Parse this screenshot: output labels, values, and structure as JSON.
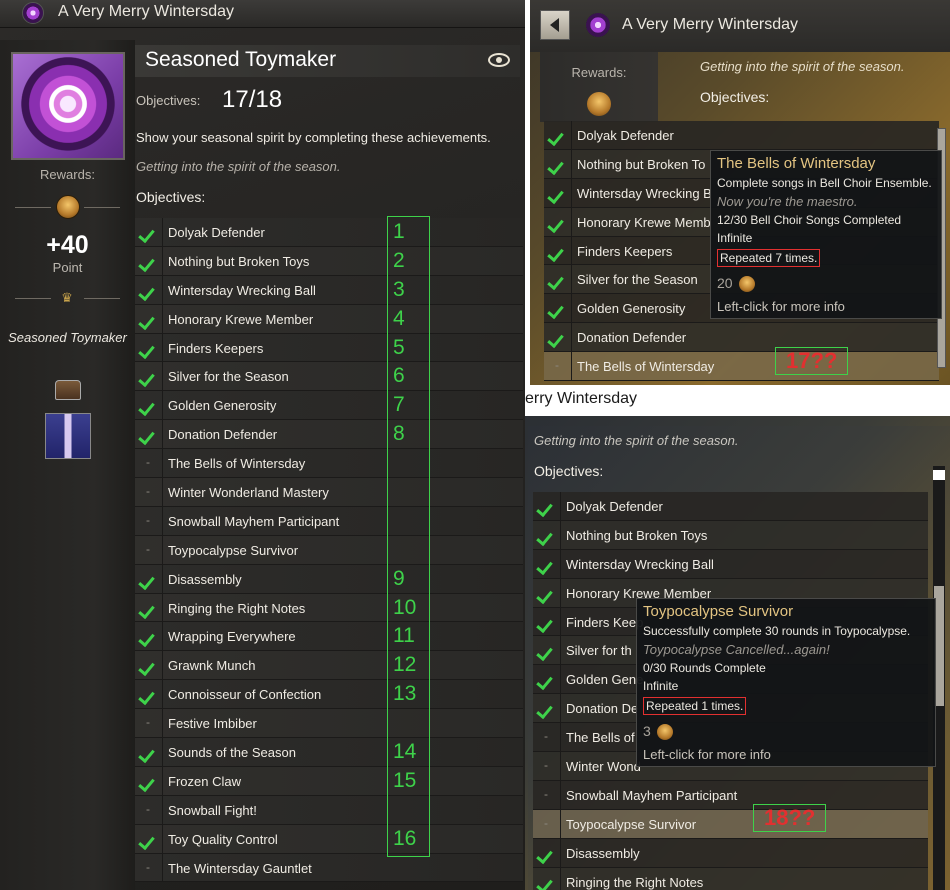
{
  "left": {
    "window_title": "A Very Merry Wintersday",
    "header_title": "Seasoned Toymaker",
    "rewards_label": "Rewards:",
    "points": "+40",
    "points_label": "Point",
    "title_reward": "Seasoned Toymaker",
    "objectives_label": "Objectives:",
    "objectives_value": "17/18",
    "description": "Show your seasonal spirit by completing these achievements.",
    "flavor": "Getting into the spirit of the season.",
    "objectives_heading": "Objectives:",
    "items": [
      {
        "label": "Dolyak Defender",
        "done": true,
        "num": "1"
      },
      {
        "label": "Nothing but Broken Toys",
        "done": true,
        "num": "2"
      },
      {
        "label": "Wintersday Wrecking Ball",
        "done": true,
        "num": "3"
      },
      {
        "label": "Honorary Krewe Member",
        "done": true,
        "num": "4"
      },
      {
        "label": "Finders Keepers",
        "done": true,
        "num": "5"
      },
      {
        "label": "Silver for the Season",
        "done": true,
        "num": "6"
      },
      {
        "label": "Golden Generosity",
        "done": true,
        "num": "7"
      },
      {
        "label": "Donation Defender",
        "done": true,
        "num": "8"
      },
      {
        "label": "The Bells of Wintersday",
        "done": false,
        "num": ""
      },
      {
        "label": "Winter Wonderland Mastery",
        "done": false,
        "num": ""
      },
      {
        "label": "Snowball Mayhem Participant",
        "done": false,
        "num": ""
      },
      {
        "label": "Toypocalypse Survivor",
        "done": false,
        "num": ""
      },
      {
        "label": "Disassembly",
        "done": true,
        "num": "9"
      },
      {
        "label": "Ringing the Right Notes",
        "done": true,
        "num": "10"
      },
      {
        "label": "Wrapping Everywhere",
        "done": true,
        "num": "11"
      },
      {
        "label": "Grawnk Munch",
        "done": true,
        "num": "12"
      },
      {
        "label": "Connoisseur of Confection",
        "done": true,
        "num": "13"
      },
      {
        "label": "Festive Imbiber",
        "done": false,
        "num": ""
      },
      {
        "label": "Sounds of the Season",
        "done": true,
        "num": "14"
      },
      {
        "label": "Frozen Claw",
        "done": true,
        "num": "15"
      },
      {
        "label": "Snowball Fight!",
        "done": false,
        "num": ""
      },
      {
        "label": "Toy Quality Control",
        "done": true,
        "num": "16"
      },
      {
        "label": "The Wintersday Gauntlet",
        "done": false,
        "num": ""
      }
    ]
  },
  "right_top": {
    "window_title": "A Very Merry Wintersday",
    "rewards_label": "Rewards:",
    "flavor": "Getting into the spirit of the season.",
    "objectives_heading": "Objectives:",
    "items": [
      {
        "label": "Dolyak Defender",
        "done": true
      },
      {
        "label": "Nothing but Broken To",
        "done": true
      },
      {
        "label": "Wintersday Wrecking B",
        "done": true
      },
      {
        "label": "Honorary Krewe Memb",
        "done": true
      },
      {
        "label": "Finders Keepers",
        "done": true
      },
      {
        "label": "Silver for the Season",
        "done": true
      },
      {
        "label": "Golden Generosity",
        "done": true
      },
      {
        "label": "Donation Defender",
        "done": true
      },
      {
        "label": "The Bells of Wintersday",
        "done": false
      }
    ],
    "tooltip": {
      "title": "The Bells of Wintersday",
      "desc": "Complete songs in Bell Choir Ensemble.",
      "flavor": "Now you're the maestro.",
      "progress": "12/30 Bell Choir Songs Completed",
      "repeat": "Infinite",
      "repeated": "Repeated 7 times.",
      "reward": "20",
      "footer": "Left-click for more info"
    },
    "annotation": "17??"
  },
  "right_bottom": {
    "window_title_partial": "erry Wintersday",
    "flavor": "Getting into the spirit of the season.",
    "objectives_heading": "Objectives:",
    "items": [
      {
        "label": "Dolyak Defender",
        "done": true
      },
      {
        "label": "Nothing but Broken Toys",
        "done": true
      },
      {
        "label": "Wintersday Wrecking Ball",
        "done": true
      },
      {
        "label": "Honorary Krewe Member",
        "done": true
      },
      {
        "label": "Finders Keep",
        "done": true
      },
      {
        "label": "Silver for th",
        "done": true
      },
      {
        "label": "Golden Gene",
        "done": true
      },
      {
        "label": "Donation De",
        "done": true
      },
      {
        "label": "The Bells of",
        "done": false
      },
      {
        "label": "Winter Wond",
        "done": false
      },
      {
        "label": "Snowball Mayhem Participant",
        "done": false
      },
      {
        "label": "Toypocalypse Survivor",
        "done": false
      },
      {
        "label": "Disassembly",
        "done": true
      },
      {
        "label": "Ringing the Right Notes",
        "done": true
      }
    ],
    "tooltip": {
      "title": "Toypocalypse Survivor",
      "desc": "Successfully complete 30 rounds in Toypocalypse.",
      "flavor": "Toypocalypse Cancelled...again!",
      "progress": "0/30 Rounds Complete",
      "repeat": "Infinite",
      "repeated": "Repeated 1 times.",
      "reward": "3",
      "footer": "Left-click for more info"
    },
    "annotation": "18??"
  }
}
